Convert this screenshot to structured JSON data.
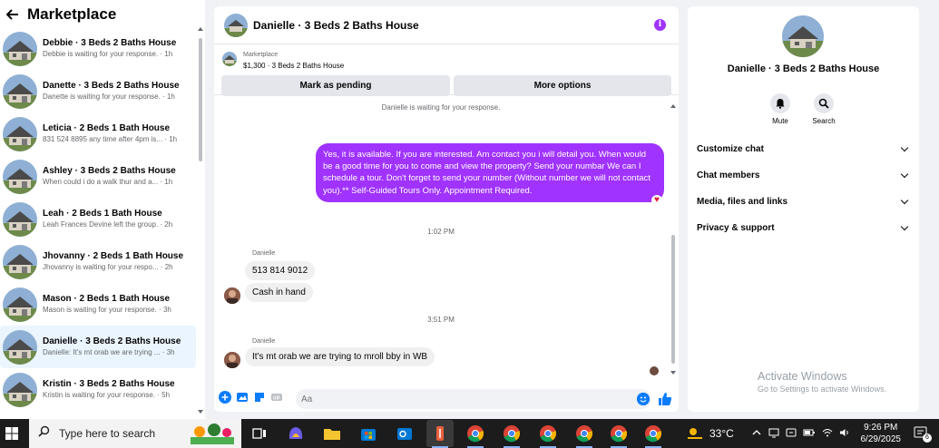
{
  "sidebar": {
    "title": "Marketplace",
    "conversations": [
      {
        "title": "Debbie · 3 Beds 2 Baths House",
        "preview": "Debbie is waiting for your response. · 1h",
        "active": false
      },
      {
        "title": "Danette · 3 Beds 2 Baths House",
        "preview": "Danette is waiting for your response. · 1h",
        "active": false
      },
      {
        "title": "Leticia · 2 Beds 1 Bath House",
        "preview": "831 524 8895 any time after 4pm is... · 1h",
        "active": false
      },
      {
        "title": "Ashley · 3 Beds 2 Baths House",
        "preview": "When could i do a walk thur and a... · 1h",
        "active": false
      },
      {
        "title": "Leah · 2 Beds 1 Bath House",
        "preview": "Leah Frances Devine left the group. · 2h",
        "active": false
      },
      {
        "title": "Jhovanny · 2 Beds 1 Bath House",
        "preview": "Jhovanny is waiting for your respo... · 2h",
        "active": false
      },
      {
        "title": "Mason · 2 Beds 1 Bath House",
        "preview": "Mason is waiting for your response. · 3h",
        "active": false
      },
      {
        "title": "Danielle · 3 Beds 2 Baths House",
        "preview": "Danielle: It's mt orab we are trying ... · 3h",
        "active": true
      },
      {
        "title": "Kristin · 3 Beds 2 Baths House",
        "preview": "Kristin is waiting for your response. · 5h",
        "active": false
      }
    ]
  },
  "chat": {
    "title": "Danielle · 3 Beds 2 Baths House",
    "marketplace_label": "Marketplace",
    "listing": "$1,300 · 3 Beds 2 Baths House",
    "mark_pending_label": "Mark as pending",
    "more_options_label": "More options",
    "waiting_note": "Danielle is waiting for your response.",
    "sent_message": "Yes, it is available. If you are interested.  Am contact you i will detail you.  When would be a good time for you to come and view the property? Send your numbar We can I schedule a tour.  Don't forget to send your number (Without number we will not contact you).** Self-Guided Tours Only. Appointment Required.",
    "time1": "1:02 PM",
    "sender1": "Danielle",
    "msg1": "513 814 9012",
    "msg2": "Cash in hand",
    "time2": "3:51 PM",
    "sender2": "Danielle",
    "msg3": "It's mt orab we are trying to mroll bby in WB",
    "input_placeholder": "Aa"
  },
  "details": {
    "name": "Danielle · 3 Beds 2 Baths House",
    "mute_label": "Mute",
    "search_label": "Search",
    "sections": [
      "Customize chat",
      "Chat members",
      "Media, files and links",
      "Privacy & support"
    ],
    "watermark_title": "Activate Windows",
    "watermark_sub": "Go to Settings to activate Windows."
  },
  "taskbar": {
    "search_text": "Type here to search",
    "temperature": "33°C",
    "time": "9:26 PM",
    "date": "6/29/2025",
    "notification_count": "6"
  },
  "colors": {
    "accent_purple": "#a033ff",
    "messenger_blue": "#0a7cff",
    "active_row": "#ebf5ff"
  }
}
